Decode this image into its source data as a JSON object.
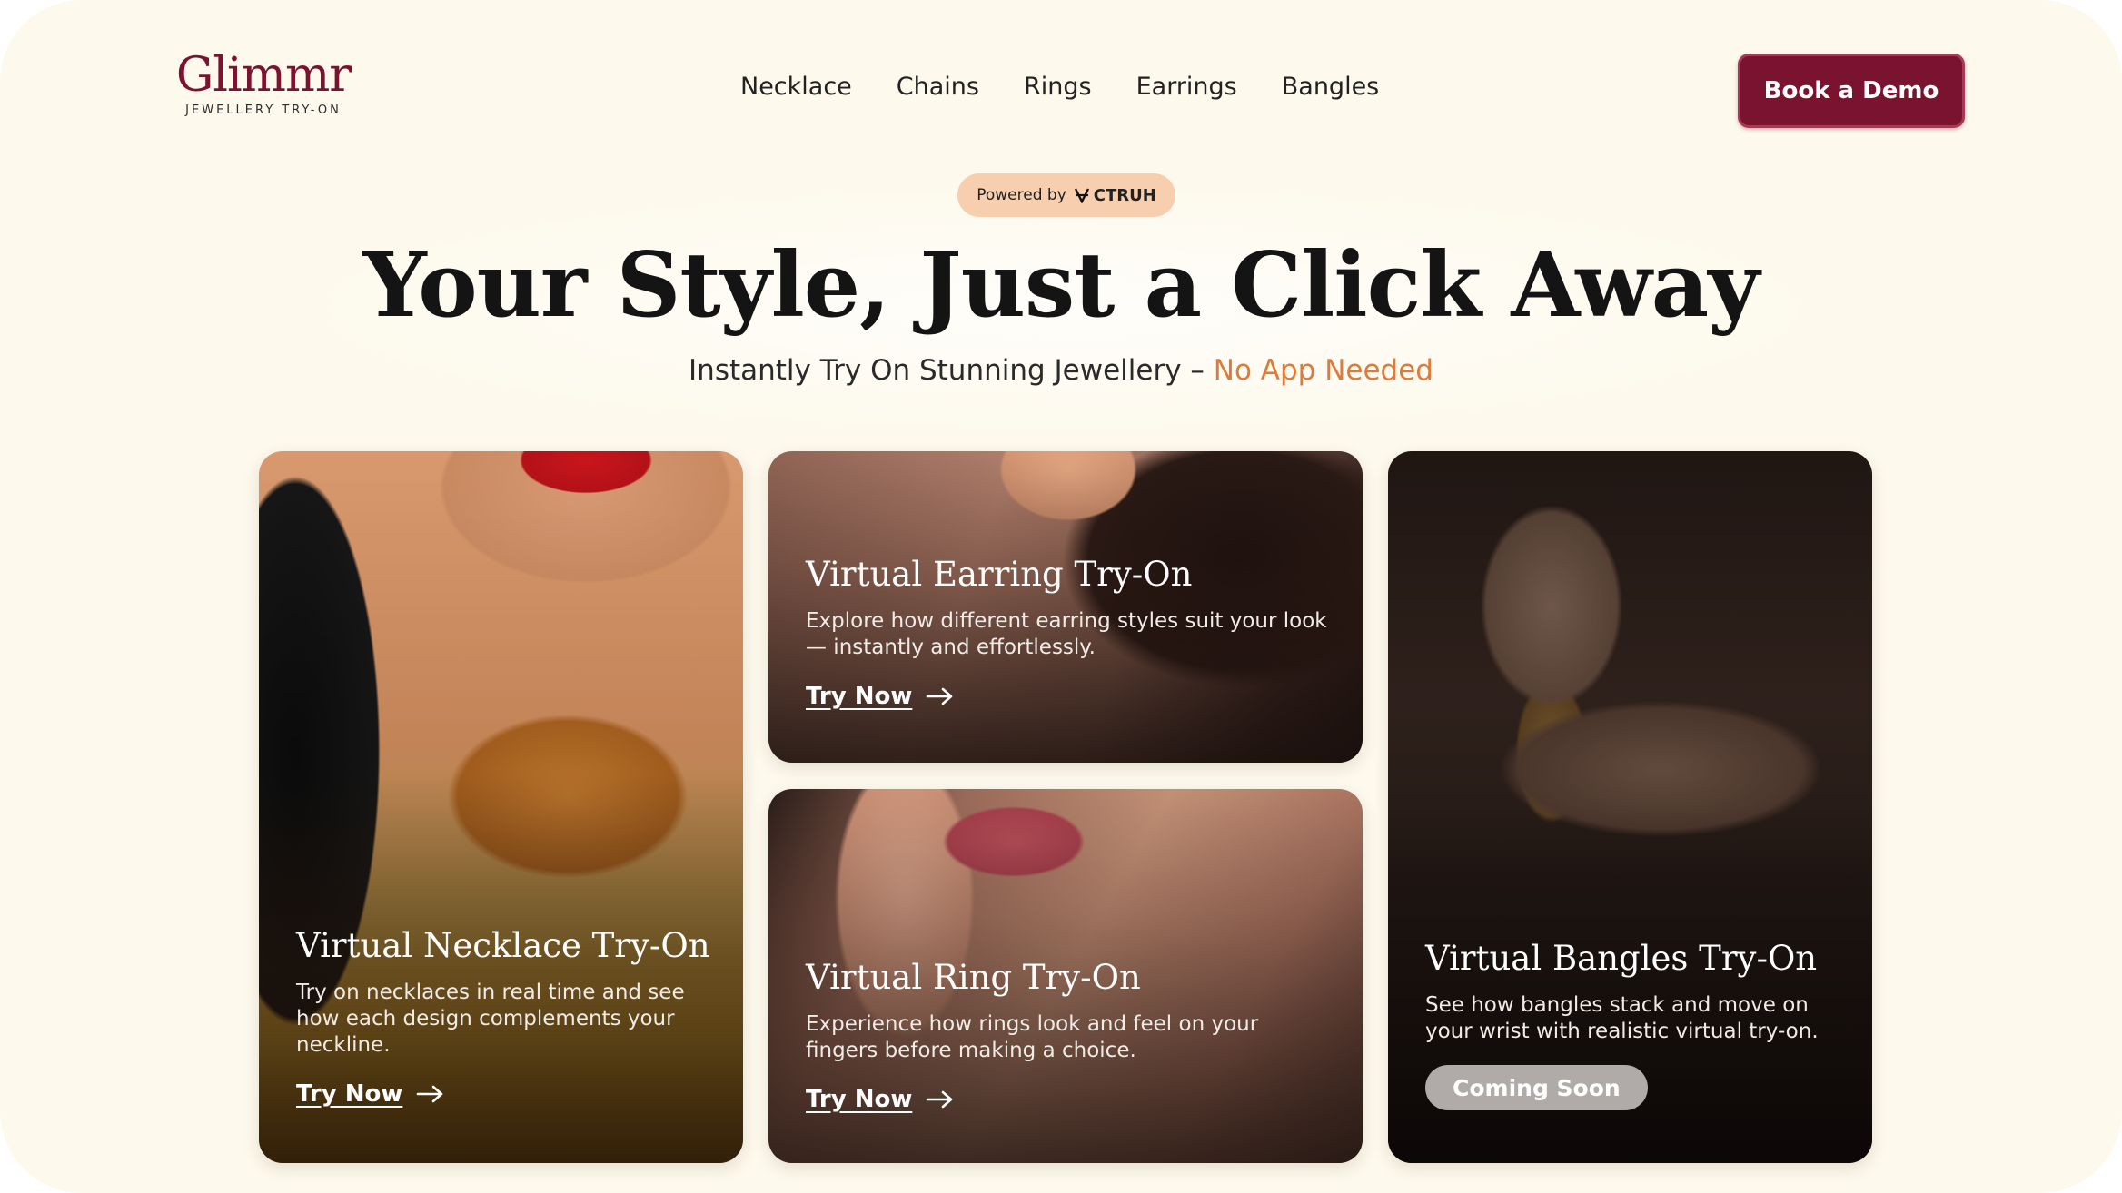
{
  "header": {
    "logo_word": "Glimmr",
    "logo_tagline": "JEWELLERY TRY-ON",
    "nav": [
      "Necklace",
      "Chains",
      "Rings",
      "Earrings",
      "Bangles"
    ],
    "cta_label": "Book a Demo"
  },
  "hero": {
    "powered_prefix": "Powered by",
    "powered_brand": "CTRUH",
    "title": "Your Style, Just a Click Away",
    "subtitle_main": "Instantly Try On Stunning Jewellery –",
    "subtitle_accent": "No App Needed"
  },
  "cards": {
    "necklace": {
      "title": "Virtual Necklace Try-On",
      "desc": "Try on necklaces in real time and see how each design complements your neckline.",
      "cta": "Try Now"
    },
    "earring": {
      "title": "Virtual Earring Try-On",
      "desc": "Explore how different earring styles suit your look — instantly and effortlessly.",
      "cta": "Try Now"
    },
    "ring": {
      "title": "Virtual Ring Try-On",
      "desc": "Experience how rings look and feel on your fingers before making a choice.",
      "cta": "Try Now"
    },
    "bangles": {
      "title": "Virtual Bangles Try-On",
      "desc": "See how bangles stack and move on your wrist with realistic virtual try-on.",
      "badge": "Coming Soon"
    }
  },
  "colors": {
    "page_bg": "#fdf9ec",
    "brand": "#7a1330",
    "accent": "#e07a38",
    "powered_pill": "#f7cfae"
  },
  "icons": [
    "ctruh-logo-icon",
    "arrow-right-icon"
  ]
}
